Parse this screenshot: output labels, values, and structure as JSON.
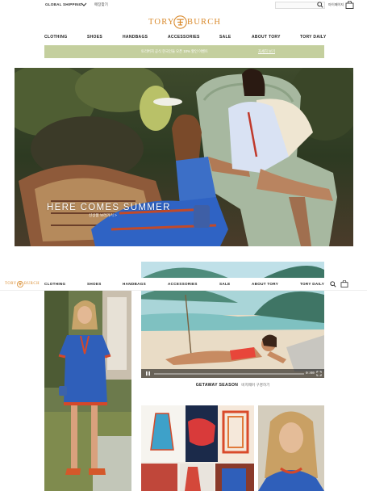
{
  "topbar": {
    "shipping_label": "GLOBAL SHIPPING",
    "chevron_icon": "chevron-down-icon",
    "country_link": "매장찾기",
    "search_placeholder": "",
    "search_icon": "search-icon",
    "account_link": "마이페이지",
    "bag_icon": "shopping-bag-icon"
  },
  "logo": {
    "left": "TORY",
    "right": "BURCH"
  },
  "nav": {
    "items": [
      "CLOTHING",
      "SHOES",
      "HANDBAGS",
      "ACCESSORIES",
      "SALE",
      "ABOUT TORY",
      "TORY DAILY"
    ]
  },
  "promo": {
    "text": "토리버치 공식 한국인들 오픈 10% 할인 이벤트",
    "link": "자세히 보기",
    "color": "#c4cf9e"
  },
  "hero": {
    "title": "HERE COMES SUMMER",
    "subtitle": "신상품 보러가기 >"
  },
  "sticky_nav": {
    "logo_left": "TORY",
    "logo_right": "BURCH",
    "items": [
      "CLOTHING",
      "SHOES",
      "HANDBAGS",
      "ACCESSORIES",
      "SALE",
      "ABOUT TORY",
      "TORY DAILY"
    ]
  },
  "video": {
    "progress": 0.0,
    "time": "0:00"
  },
  "caption": {
    "title": "GETAWAY SEASON",
    "text": "비치웨어 구경하기"
  },
  "colors": {
    "brand": "#d98a2c",
    "promo_bg": "#c4cf9e"
  }
}
